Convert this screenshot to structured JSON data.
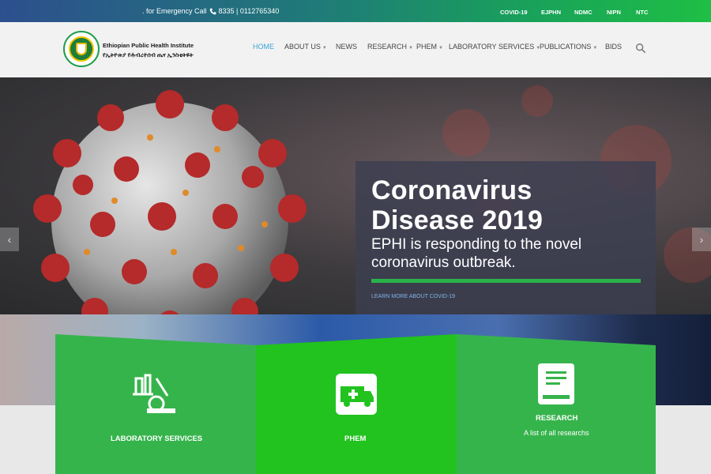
{
  "topbar": {
    "emergency_prefix": ". for Emergency Call",
    "emergency_numbers": "8335 | 0112765340",
    "links": [
      "COVID-19",
      "EJPHN",
      "NDMC",
      "NIPN",
      "NTC"
    ]
  },
  "header": {
    "logo_name_en": "Ethiopian Public Health Institute",
    "logo_name_am": "የኢትዮጵያ የሕብረተሰብ ጤና ኢንስቲትዩት"
  },
  "nav": {
    "items": [
      {
        "label": "HOME",
        "active": true,
        "dropdown": false
      },
      {
        "label": "ABOUT US",
        "active": false,
        "dropdown": true
      },
      {
        "label": "NEWS",
        "active": false,
        "dropdown": false
      },
      {
        "label": "RESEARCH",
        "active": false,
        "dropdown": true
      },
      {
        "label": "PHEM",
        "active": false,
        "dropdown": true
      },
      {
        "label": "LABORATORY SERVICES",
        "active": false,
        "dropdown": true
      },
      {
        "label": "PUBLICATIONS",
        "active": false,
        "dropdown": true
      },
      {
        "label": "BIDS",
        "active": false,
        "dropdown": false
      }
    ],
    "search_icon": "search-icon"
  },
  "hero": {
    "title_line1": "Coronavirus",
    "title_line2": "Disease 2019",
    "subtitle_line1": "EPHI is responding to the novel",
    "subtitle_line2": "coronavirus outbreak.",
    "link": "LEARN MORE ABOUT COVID-19"
  },
  "cards": [
    {
      "title": "LABORATORY SERVICES",
      "subtitle": "",
      "icon": "microscope-icon"
    },
    {
      "title": "PHEM",
      "subtitle": "",
      "icon": "ambulance-icon"
    },
    {
      "title": "RESEARCH",
      "subtitle": "A list of all researchs",
      "icon": "book-icon"
    }
  ],
  "colors": {
    "accent_green": "#35b54a",
    "nav_active": "#3ba5d8",
    "caption_bar": "#2ab24a"
  }
}
